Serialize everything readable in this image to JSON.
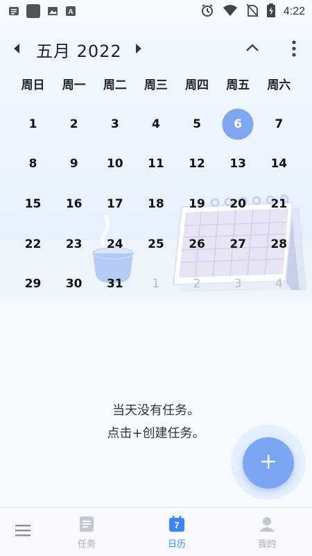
{
  "status_bar": {
    "time": "4:22"
  },
  "header": {
    "month_title": "五月  2022"
  },
  "weekdays": [
    "周日",
    "周一",
    "周二",
    "周三",
    "周四",
    "周五",
    "周六"
  ],
  "weeks": [
    [
      "",
      "",
      "",
      "",
      "",
      "",
      ""
    ],
    [
      "1",
      "2",
      "3",
      "4",
      "5",
      "6",
      "7"
    ],
    [
      "8",
      "9",
      "10",
      "11",
      "12",
      "13",
      "14"
    ],
    [
      "15",
      "16",
      "17",
      "18",
      "19",
      "20",
      "21"
    ],
    [
      "22",
      "23",
      "24",
      "25",
      "26",
      "27",
      "28"
    ],
    [
      "29",
      "30",
      "31",
      "1",
      "2",
      "3",
      "4"
    ]
  ],
  "days": {
    "d1": "1",
    "d2": "2",
    "d3": "3",
    "d4": "4",
    "d5": "5",
    "d6": "6",
    "d7": "7",
    "d8": "8",
    "d9": "9",
    "d10": "10",
    "d11": "11",
    "d12": "12",
    "d13": "13",
    "d14": "14",
    "d15": "15",
    "d16": "16",
    "d17": "17",
    "d18": "18",
    "d19": "19",
    "d20": "20",
    "d21": "21",
    "d22": "22",
    "d23": "23",
    "d24": "24",
    "d25": "25",
    "d26": "26",
    "d27": "27",
    "d28": "28",
    "d29": "29",
    "d30": "30",
    "d31": "31",
    "n1": "1",
    "n2": "2",
    "n3": "3",
    "n4": "4"
  },
  "selected_day": "6",
  "empty_state": {
    "line1": "当天没有任务。",
    "line2": "点击+创建任务。"
  },
  "fab": {
    "label": "+"
  },
  "bottom_nav": {
    "tasks_label": "任务",
    "calendar_label": "日历",
    "calendar_icon_text": "7",
    "mine_label": "我的"
  },
  "colors": {
    "accent": "#3d86f5",
    "selected": "#7fa6ee",
    "fab": "#7ba6f2"
  },
  "icons": [
    "notes-icon",
    "app-square-icon",
    "image-icon",
    "font-icon",
    "alarm-icon",
    "wifi-icon",
    "no-sim-icon",
    "battery-charging-icon",
    "triangle-left-icon",
    "triangle-right-icon",
    "chevron-up-icon",
    "more-vert-icon",
    "menu-icon",
    "tasks-icon",
    "calendar-icon",
    "profile-icon",
    "plus-icon"
  ]
}
